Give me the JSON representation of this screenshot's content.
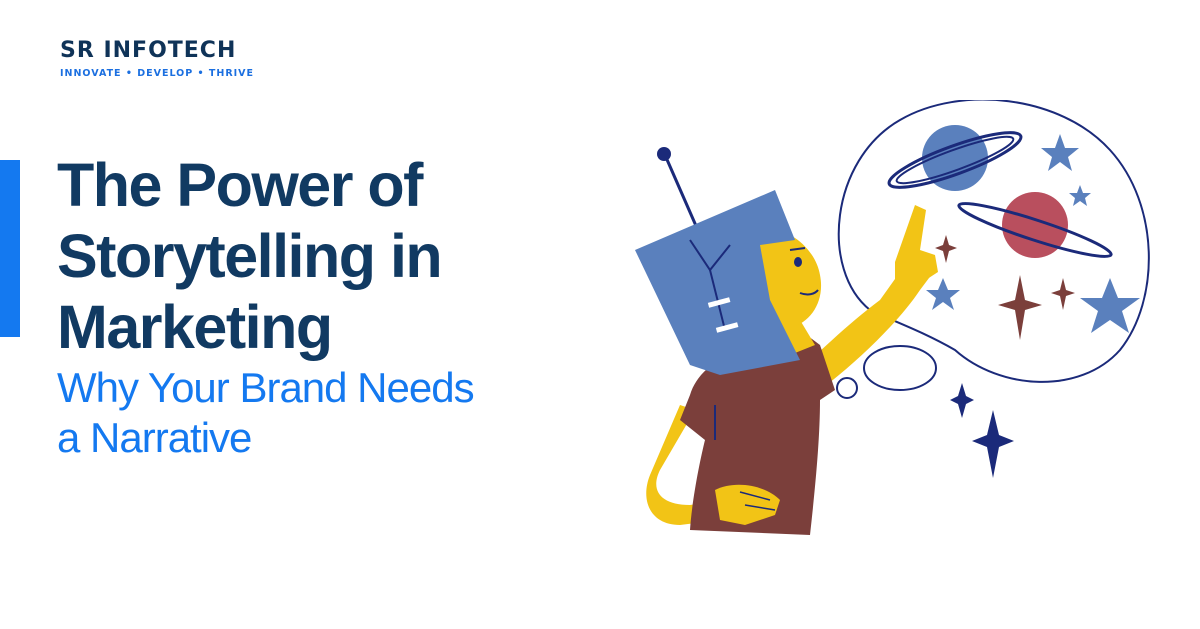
{
  "brand": {
    "name": "SR INFOTECH",
    "tagline": "INNOVATE • DEVELOP • THRIVE"
  },
  "headline": {
    "lines": [
      "The Power of",
      "Storytelling in",
      "Marketing"
    ]
  },
  "subheadline": {
    "lines": [
      "Why Your Brand Needs",
      "a Narrative"
    ]
  },
  "colors": {
    "navy": "#113a62",
    "blue": "#1479f0",
    "yellow": "#f2c416",
    "brown": "#7b3f3b",
    "slate_blue": "#5a80bd",
    "red_planet": "#b94f5e",
    "ink": "#1b2a7a"
  },
  "illustration": {
    "subject": "child-with-helmet-pointing-at-thought-bubble-with-planets-and-stars"
  }
}
